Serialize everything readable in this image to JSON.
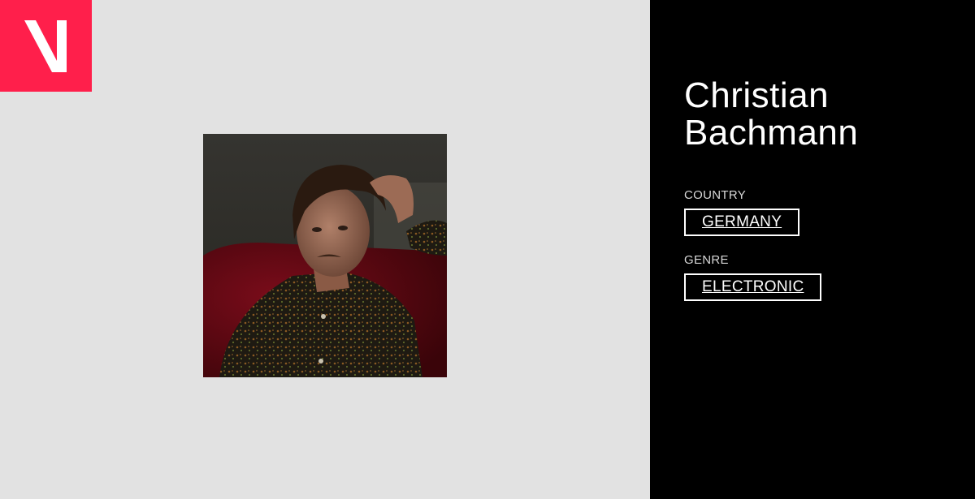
{
  "brand": {
    "logo_icon": "v-logo-icon",
    "accent_color": "#ff1f4b"
  },
  "artist": {
    "first_name": "Christian",
    "last_name": "Bachmann",
    "photo_icon": "artist-portrait"
  },
  "details": {
    "country_label": "COUNTRY",
    "country_value": "GERMANY",
    "genre_label": "GENRE",
    "genre_value": "ELECTRONIC"
  },
  "colors": {
    "left_background": "#e2e2e2",
    "right_background": "#000000",
    "text": "#ffffff"
  }
}
